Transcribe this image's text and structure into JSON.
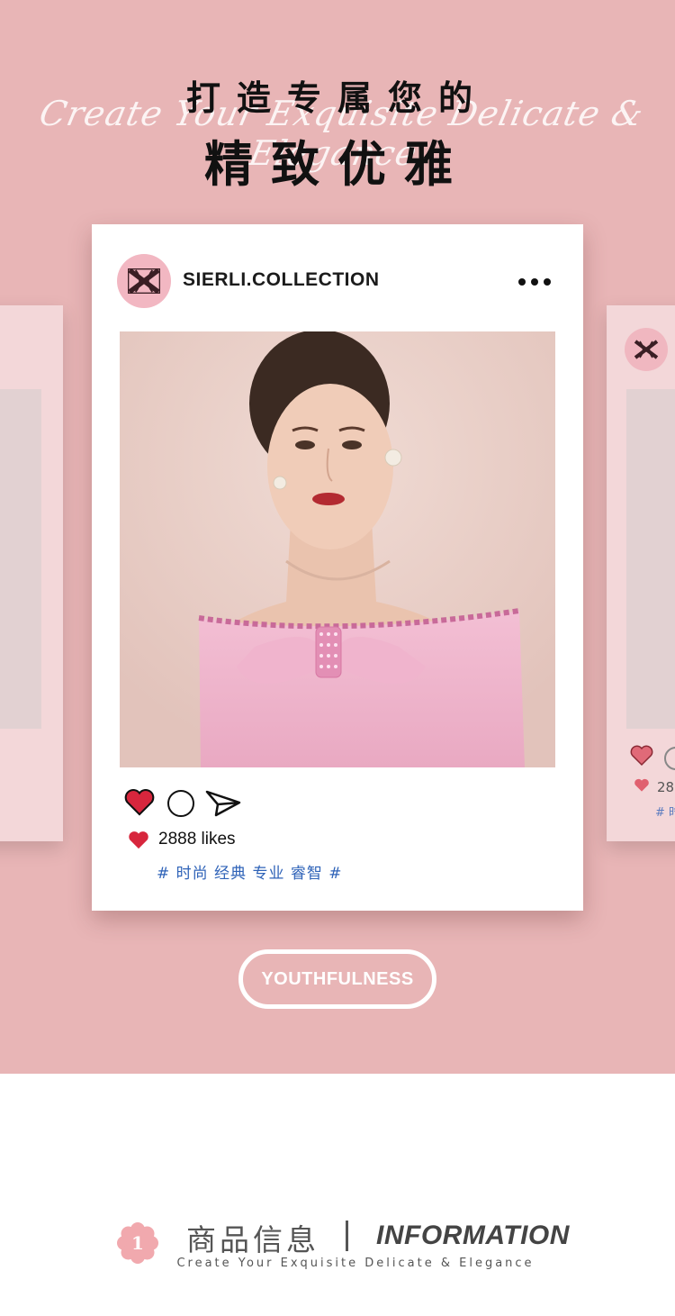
{
  "header": {
    "title_line1": "打造专属您的",
    "title_line2": "精致优雅",
    "script_text": "Create Your Exquisite Delicate & Elegance"
  },
  "post": {
    "account_name": "SIERLI.COLLECTION",
    "more_icon": "more-dots-icon",
    "likes_text": "2888 likes",
    "tags_text": "# 时尚 经典 专业 睿智 #",
    "actions": [
      "heart-icon",
      "comment-icon",
      "send-icon"
    ]
  },
  "side_right": {
    "likes_text": "28",
    "tag_text": "# 时"
  },
  "cta": {
    "label": "YOUTHFULNESS"
  },
  "info": {
    "badge_number": "1",
    "title_cn": "商品信息",
    "title_en": "INFORMATION",
    "subtitle": "Create Your Exquisite Delicate & Elegance"
  },
  "colors": {
    "hero_bg": "#e8b5b6",
    "card_bg": "#ffffff",
    "heart": "#d7263d",
    "tag_blue": "#2f63b8",
    "avatar_pink": "#f2b7c2"
  }
}
